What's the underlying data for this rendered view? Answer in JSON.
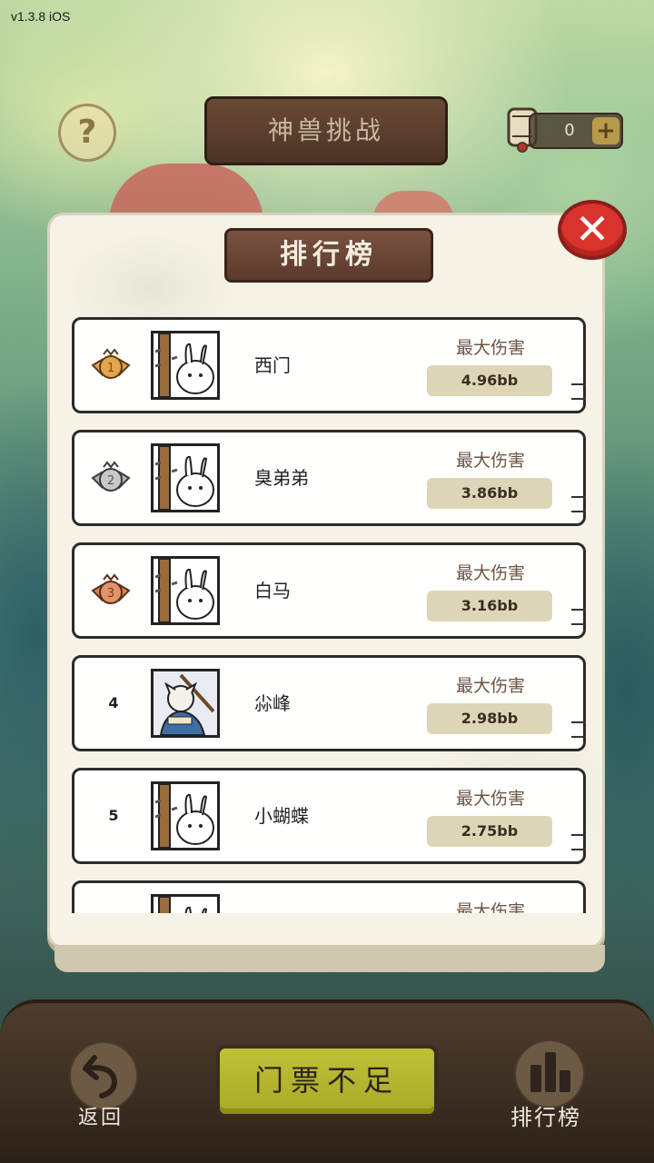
{
  "version": "v1.3.8 iOS",
  "header": {
    "help_label": "?",
    "title": "神兽挑战",
    "ticket_count": "0",
    "ticket_plus": "+"
  },
  "modal": {
    "title": "排行榜",
    "close_label": "✕",
    "damage_label": "最大伤害",
    "rows": [
      {
        "rank": "1",
        "name": "西门",
        "damage": "4.96bb",
        "medal": "gold"
      },
      {
        "rank": "2",
        "name": "臭弟弟",
        "damage": "3.86bb",
        "medal": "silver"
      },
      {
        "rank": "3",
        "name": "白马",
        "damage": "3.16bb",
        "medal": "bronze"
      },
      {
        "rank": "4",
        "name": "尛峰",
        "damage": "2.98bb",
        "medal": ""
      },
      {
        "rank": "5",
        "name": "小蝴蝶",
        "damage": "2.75bb",
        "medal": ""
      },
      {
        "rank": "",
        "name": "",
        "damage": "",
        "medal": ""
      }
    ]
  },
  "bottom": {
    "back_label": "返回",
    "ticket_button": "门票不足",
    "rank_label": "排行榜"
  },
  "colors": {
    "gold": "#e4a64a",
    "silver": "#b5b5b5",
    "bronze": "#d9855a",
    "close": "#d9332d",
    "ticket_button": "#b4b62f"
  }
}
